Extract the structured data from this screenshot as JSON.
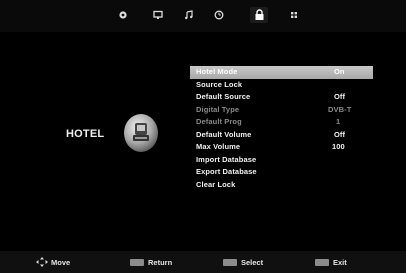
{
  "topbar": {
    "icons": [
      {
        "name": "picture-icon"
      },
      {
        "name": "sound-screen-icon"
      },
      {
        "name": "music-note-icon"
      },
      {
        "name": "clock-icon"
      },
      {
        "name": "lock-icon",
        "active": true
      },
      {
        "name": "options-icon"
      }
    ]
  },
  "hotel": {
    "label": "HOTEL",
    "badge_icon": "hotel-bell-icon"
  },
  "menu": {
    "items": [
      {
        "label": "Hotel Mode",
        "value": "On"
      },
      {
        "label": "Source Lock",
        "value": ""
      },
      {
        "label": "Default Source",
        "value": "Off"
      },
      {
        "label": "Digital Type",
        "value": "DVB-T"
      },
      {
        "label": "Default Prog",
        "value": "1"
      },
      {
        "label": "Default Volume",
        "value": "Off"
      },
      {
        "label": "Max Volume",
        "value": "100"
      },
      {
        "label": "Import Database",
        "value": ""
      },
      {
        "label": "Export Database",
        "value": ""
      },
      {
        "label": "Clear Lock",
        "value": ""
      }
    ],
    "selected_index": 0,
    "disabled_indices": [
      3,
      4
    ]
  },
  "legend": {
    "move": "Move",
    "return": "Return",
    "select": "Select",
    "exit": "Exit"
  },
  "colors": {
    "background": "#000000",
    "highlight": "#b8b8b8",
    "text": "#f2f2f2",
    "disabled_text": "#8a8a8a"
  }
}
